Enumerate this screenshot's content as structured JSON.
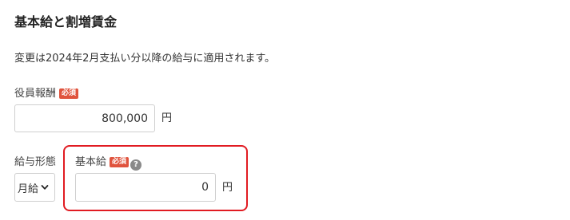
{
  "section": {
    "title": "基本給と割増賃金",
    "notice": "変更は2024年2月支払い分以降の給与に適用されます。"
  },
  "officer_pay": {
    "label": "役員報酬",
    "required_badge": "必須",
    "value": "800,000",
    "unit": "円"
  },
  "pay_type": {
    "label": "給与形態",
    "selected": "月給"
  },
  "base_pay": {
    "label": "基本給",
    "required_badge": "必須",
    "help_symbol": "?",
    "value": "0",
    "unit": "円"
  },
  "colors": {
    "required_badge": "#e0533d",
    "highlight_border": "#e11b22",
    "input_border": "#cfcfcf"
  }
}
